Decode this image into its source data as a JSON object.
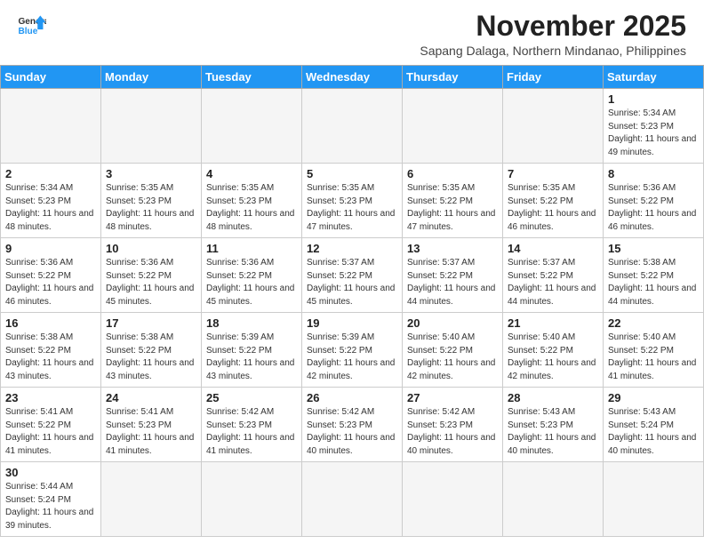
{
  "header": {
    "logo_general": "General",
    "logo_blue": "Blue",
    "month_title": "November 2025",
    "location": "Sapang Dalaga, Northern Mindanao, Philippines"
  },
  "days_of_week": [
    "Sunday",
    "Monday",
    "Tuesday",
    "Wednesday",
    "Thursday",
    "Friday",
    "Saturday"
  ],
  "weeks": [
    [
      {
        "day": "",
        "empty": true
      },
      {
        "day": "",
        "empty": true
      },
      {
        "day": "",
        "empty": true
      },
      {
        "day": "",
        "empty": true
      },
      {
        "day": "",
        "empty": true
      },
      {
        "day": "",
        "empty": true
      },
      {
        "day": "1",
        "sunrise": "5:34 AM",
        "sunset": "5:23 PM",
        "daylight": "11 hours and 49 minutes."
      }
    ],
    [
      {
        "day": "2",
        "sunrise": "5:34 AM",
        "sunset": "5:23 PM",
        "daylight": "11 hours and 48 minutes."
      },
      {
        "day": "3",
        "sunrise": "5:35 AM",
        "sunset": "5:23 PM",
        "daylight": "11 hours and 48 minutes."
      },
      {
        "day": "4",
        "sunrise": "5:35 AM",
        "sunset": "5:23 PM",
        "daylight": "11 hours and 48 minutes."
      },
      {
        "day": "5",
        "sunrise": "5:35 AM",
        "sunset": "5:23 PM",
        "daylight": "11 hours and 47 minutes."
      },
      {
        "day": "6",
        "sunrise": "5:35 AM",
        "sunset": "5:22 PM",
        "daylight": "11 hours and 47 minutes."
      },
      {
        "day": "7",
        "sunrise": "5:35 AM",
        "sunset": "5:22 PM",
        "daylight": "11 hours and 46 minutes."
      },
      {
        "day": "8",
        "sunrise": "5:36 AM",
        "sunset": "5:22 PM",
        "daylight": "11 hours and 46 minutes."
      }
    ],
    [
      {
        "day": "9",
        "sunrise": "5:36 AM",
        "sunset": "5:22 PM",
        "daylight": "11 hours and 46 minutes."
      },
      {
        "day": "10",
        "sunrise": "5:36 AM",
        "sunset": "5:22 PM",
        "daylight": "11 hours and 45 minutes."
      },
      {
        "day": "11",
        "sunrise": "5:36 AM",
        "sunset": "5:22 PM",
        "daylight": "11 hours and 45 minutes."
      },
      {
        "day": "12",
        "sunrise": "5:37 AM",
        "sunset": "5:22 PM",
        "daylight": "11 hours and 45 minutes."
      },
      {
        "day": "13",
        "sunrise": "5:37 AM",
        "sunset": "5:22 PM",
        "daylight": "11 hours and 44 minutes."
      },
      {
        "day": "14",
        "sunrise": "5:37 AM",
        "sunset": "5:22 PM",
        "daylight": "11 hours and 44 minutes."
      },
      {
        "day": "15",
        "sunrise": "5:38 AM",
        "sunset": "5:22 PM",
        "daylight": "11 hours and 44 minutes."
      }
    ],
    [
      {
        "day": "16",
        "sunrise": "5:38 AM",
        "sunset": "5:22 PM",
        "daylight": "11 hours and 43 minutes."
      },
      {
        "day": "17",
        "sunrise": "5:38 AM",
        "sunset": "5:22 PM",
        "daylight": "11 hours and 43 minutes."
      },
      {
        "day": "18",
        "sunrise": "5:39 AM",
        "sunset": "5:22 PM",
        "daylight": "11 hours and 43 minutes."
      },
      {
        "day": "19",
        "sunrise": "5:39 AM",
        "sunset": "5:22 PM",
        "daylight": "11 hours and 42 minutes."
      },
      {
        "day": "20",
        "sunrise": "5:40 AM",
        "sunset": "5:22 PM",
        "daylight": "11 hours and 42 minutes."
      },
      {
        "day": "21",
        "sunrise": "5:40 AM",
        "sunset": "5:22 PM",
        "daylight": "11 hours and 42 minutes."
      },
      {
        "day": "22",
        "sunrise": "5:40 AM",
        "sunset": "5:22 PM",
        "daylight": "11 hours and 41 minutes."
      }
    ],
    [
      {
        "day": "23",
        "sunrise": "5:41 AM",
        "sunset": "5:22 PM",
        "daylight": "11 hours and 41 minutes."
      },
      {
        "day": "24",
        "sunrise": "5:41 AM",
        "sunset": "5:23 PM",
        "daylight": "11 hours and 41 minutes."
      },
      {
        "day": "25",
        "sunrise": "5:42 AM",
        "sunset": "5:23 PM",
        "daylight": "11 hours and 41 minutes."
      },
      {
        "day": "26",
        "sunrise": "5:42 AM",
        "sunset": "5:23 PM",
        "daylight": "11 hours and 40 minutes."
      },
      {
        "day": "27",
        "sunrise": "5:42 AM",
        "sunset": "5:23 PM",
        "daylight": "11 hours and 40 minutes."
      },
      {
        "day": "28",
        "sunrise": "5:43 AM",
        "sunset": "5:23 PM",
        "daylight": "11 hours and 40 minutes."
      },
      {
        "day": "29",
        "sunrise": "5:43 AM",
        "sunset": "5:24 PM",
        "daylight": "11 hours and 40 minutes."
      }
    ],
    [
      {
        "day": "30",
        "sunrise": "5:44 AM",
        "sunset": "5:24 PM",
        "daylight": "11 hours and 39 minutes."
      },
      {
        "day": "",
        "empty": true
      },
      {
        "day": "",
        "empty": true
      },
      {
        "day": "",
        "empty": true
      },
      {
        "day": "",
        "empty": true
      },
      {
        "day": "",
        "empty": true
      },
      {
        "day": "",
        "empty": true
      }
    ]
  ]
}
